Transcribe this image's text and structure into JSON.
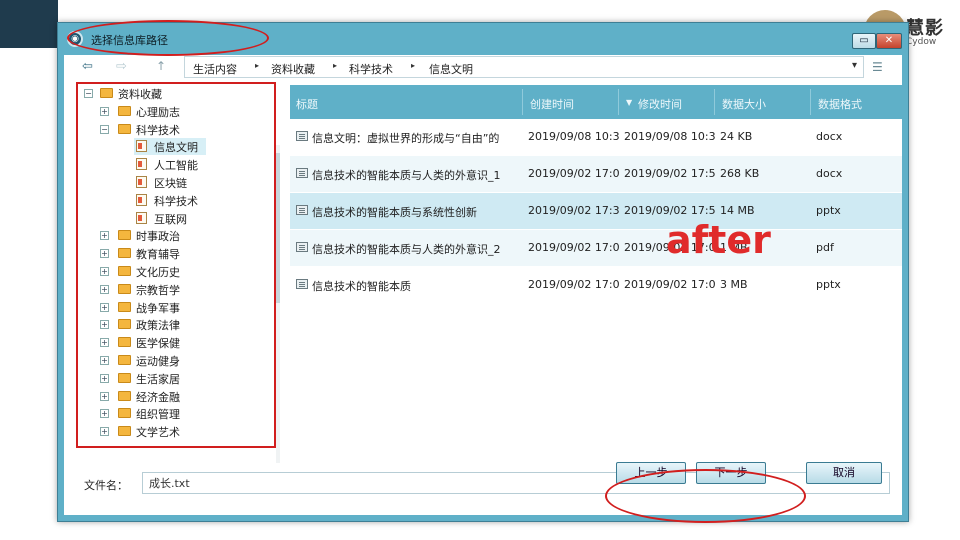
{
  "background": {
    "logo_text": "慧影",
    "logo_sub": "Cydow"
  },
  "dialog": {
    "title": "选择信息库路径",
    "min_label": "▭",
    "close_label": "✕"
  },
  "nav": {
    "back_icon": "⇦",
    "forward_icon": "⇨",
    "up_icon": "↑",
    "breadcrumbs": [
      "生活内容",
      "资料收藏",
      "科学技术",
      "信息文明"
    ],
    "separator": "▸",
    "dropdown_icon": "▾",
    "view_icon": "☰"
  },
  "tree": {
    "root": "资料收藏",
    "items": [
      {
        "label": "心理励志",
        "type": "folder",
        "toggle": "+"
      },
      {
        "label": "科学技术",
        "type": "folder",
        "toggle": "−"
      },
      {
        "label": "信息文明",
        "type": "file",
        "selected": true
      },
      {
        "label": "人工智能",
        "type": "file"
      },
      {
        "label": "区块链",
        "type": "file"
      },
      {
        "label": "科学技术",
        "type": "file"
      },
      {
        "label": "互联网",
        "type": "file"
      },
      {
        "label": "时事政治",
        "type": "folder",
        "toggle": "+"
      },
      {
        "label": "教育辅导",
        "type": "folder",
        "toggle": "+"
      },
      {
        "label": "文化历史",
        "type": "folder",
        "toggle": "+"
      },
      {
        "label": "宗教哲学",
        "type": "folder",
        "toggle": "+"
      },
      {
        "label": "战争军事",
        "type": "folder",
        "toggle": "+"
      },
      {
        "label": "政策法律",
        "type": "folder",
        "toggle": "+"
      },
      {
        "label": "医学保健",
        "type": "folder",
        "toggle": "+"
      },
      {
        "label": "运动健身",
        "type": "folder",
        "toggle": "+"
      },
      {
        "label": "生活家居",
        "type": "folder",
        "toggle": "+"
      },
      {
        "label": "经济金融",
        "type": "folder",
        "toggle": "+"
      },
      {
        "label": "组织管理",
        "type": "folder",
        "toggle": "+"
      },
      {
        "label": "文学艺术",
        "type": "folder",
        "toggle": "+"
      }
    ]
  },
  "list": {
    "columns": [
      "标题",
      "创建时间",
      "修改时间",
      "数据大小",
      "数据格式"
    ],
    "sort_indicator": "▼",
    "rows": [
      {
        "title": "信息文明：虚拟世界的形成与“自由”的",
        "created": "2019/09/08 10:3",
        "modified": "2019/09/08 10:3",
        "size": "24 KB",
        "format": "docx"
      },
      {
        "title": "信息技术的智能本质与人类的外意识_1",
        "created": "2019/09/02 17:0",
        "modified": "2019/09/02 17:5",
        "size": "268 KB",
        "format": "docx"
      },
      {
        "title": "信息技术的智能本质与系统性创新",
        "created": "2019/09/02 17:3",
        "modified": "2019/09/02 17:5",
        "size": "14 MB",
        "format": "pptx"
      },
      {
        "title": "信息技术的智能本质与人类的外意识_2",
        "created": "2019/09/02 17:0",
        "modified": "2019/09/02 17:0",
        "size": "1 MB",
        "format": "pdf"
      },
      {
        "title": "信息技术的智能本质",
        "created": "2019/09/02 17:0",
        "modified": "2019/09/02 17:0",
        "size": "3 MB",
        "format": "pptx"
      }
    ]
  },
  "overlay_text": "after",
  "footer": {
    "filename_label": "文件名：",
    "filename_value": "成长.txt",
    "prev_label": "上一步",
    "next_label": "下一步",
    "cancel_label": "取消"
  },
  "colors": {
    "accent": "#5fb0c8",
    "annotation": "#d11e1e"
  }
}
